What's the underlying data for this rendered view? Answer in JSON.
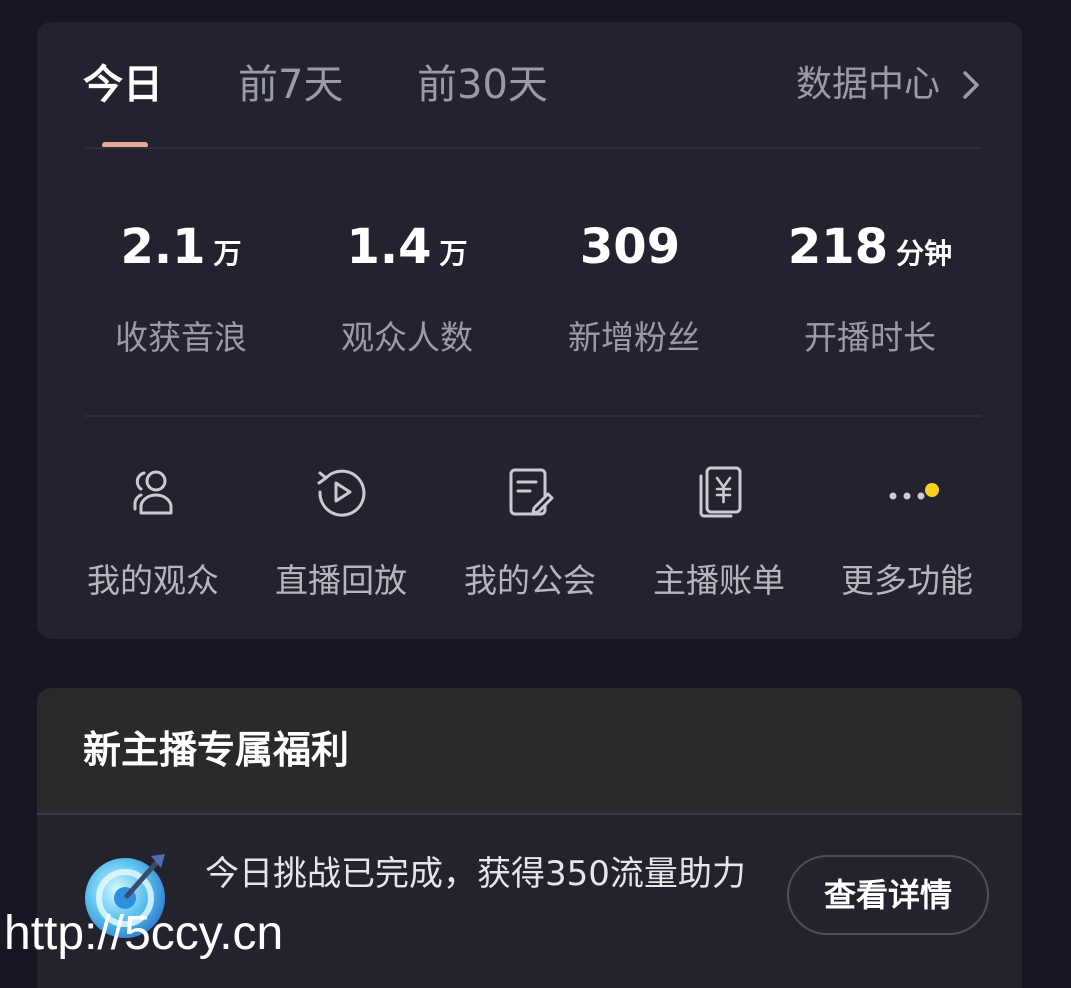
{
  "tabs": [
    {
      "label": "今日",
      "active": true
    },
    {
      "label": "前7天",
      "active": false
    },
    {
      "label": "前30天",
      "active": false
    }
  ],
  "data_center": {
    "label": "数据中心",
    "icon": "chevron-right-icon"
  },
  "stats": [
    {
      "value": "2.1",
      "unit": "万",
      "label": "收获音浪"
    },
    {
      "value": "1.4",
      "unit": "万",
      "label": "观众人数"
    },
    {
      "value": "309",
      "unit": "",
      "label": "新增粉丝"
    },
    {
      "value": "218",
      "unit": "分钟",
      "label": "开播时长"
    }
  ],
  "functions": [
    {
      "label": "我的观众",
      "icon": "audience-icon"
    },
    {
      "label": "直播回放",
      "icon": "replay-icon"
    },
    {
      "label": "我的公会",
      "icon": "guild-icon"
    },
    {
      "label": "主播账单",
      "icon": "bill-icon"
    },
    {
      "label": "更多功能",
      "icon": "more-icon",
      "notification_dot": true
    }
  ],
  "welfare": {
    "title": "新主播专属福利",
    "challenge_text": "今日挑战已完成，获得350流量助力",
    "details_button": "查看详情",
    "icon": "target-dart-icon"
  },
  "watermark": "http://5ccy.cn",
  "colors": {
    "background": "#161722",
    "card": "#232330",
    "accent_underline": "#e8a79b",
    "notification_dot": "#f7d21c",
    "muted_text": "#9a9ba6"
  }
}
